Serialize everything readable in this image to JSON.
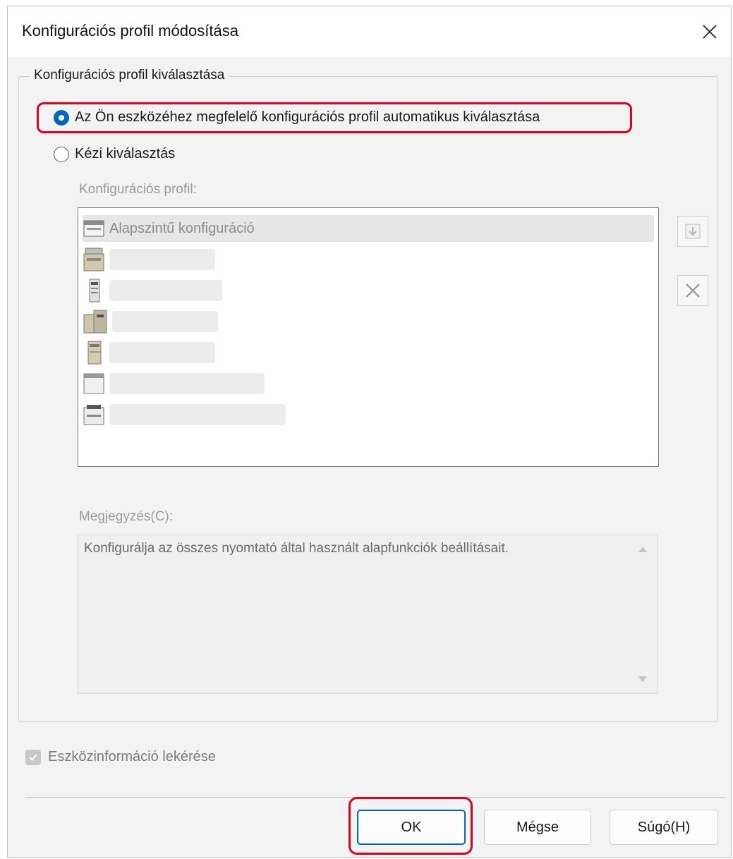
{
  "window": {
    "title": "Konfigurációs profil módosítása"
  },
  "profile_selection": {
    "group_label": "Konfigurációs profil kiválasztása",
    "auto_option": "Az Ön eszközéhez megfelelő konfigurációs profil automatikus kiválasztása",
    "manual_option": "Kézi kiválasztás",
    "selected": "auto",
    "profile_list_label": "Konfigurációs profil:",
    "profiles": [
      {
        "label": "Alapszintű konfiguráció",
        "icon": "printer-basic-icon",
        "selected": true
      }
    ],
    "memo_label": "Megjegyzés(C):",
    "memo_text": "Konfigurálja az összes nyomtató által használt alapfunkciók beállításait."
  },
  "device_info": {
    "label": "Eszközinformáció lekérése",
    "checked": true
  },
  "buttons": {
    "ok": "OK",
    "cancel": "Mégse",
    "help": "Súgó(H)"
  },
  "colors": {
    "accent": "#0067c0",
    "highlight": "#e2001a"
  }
}
